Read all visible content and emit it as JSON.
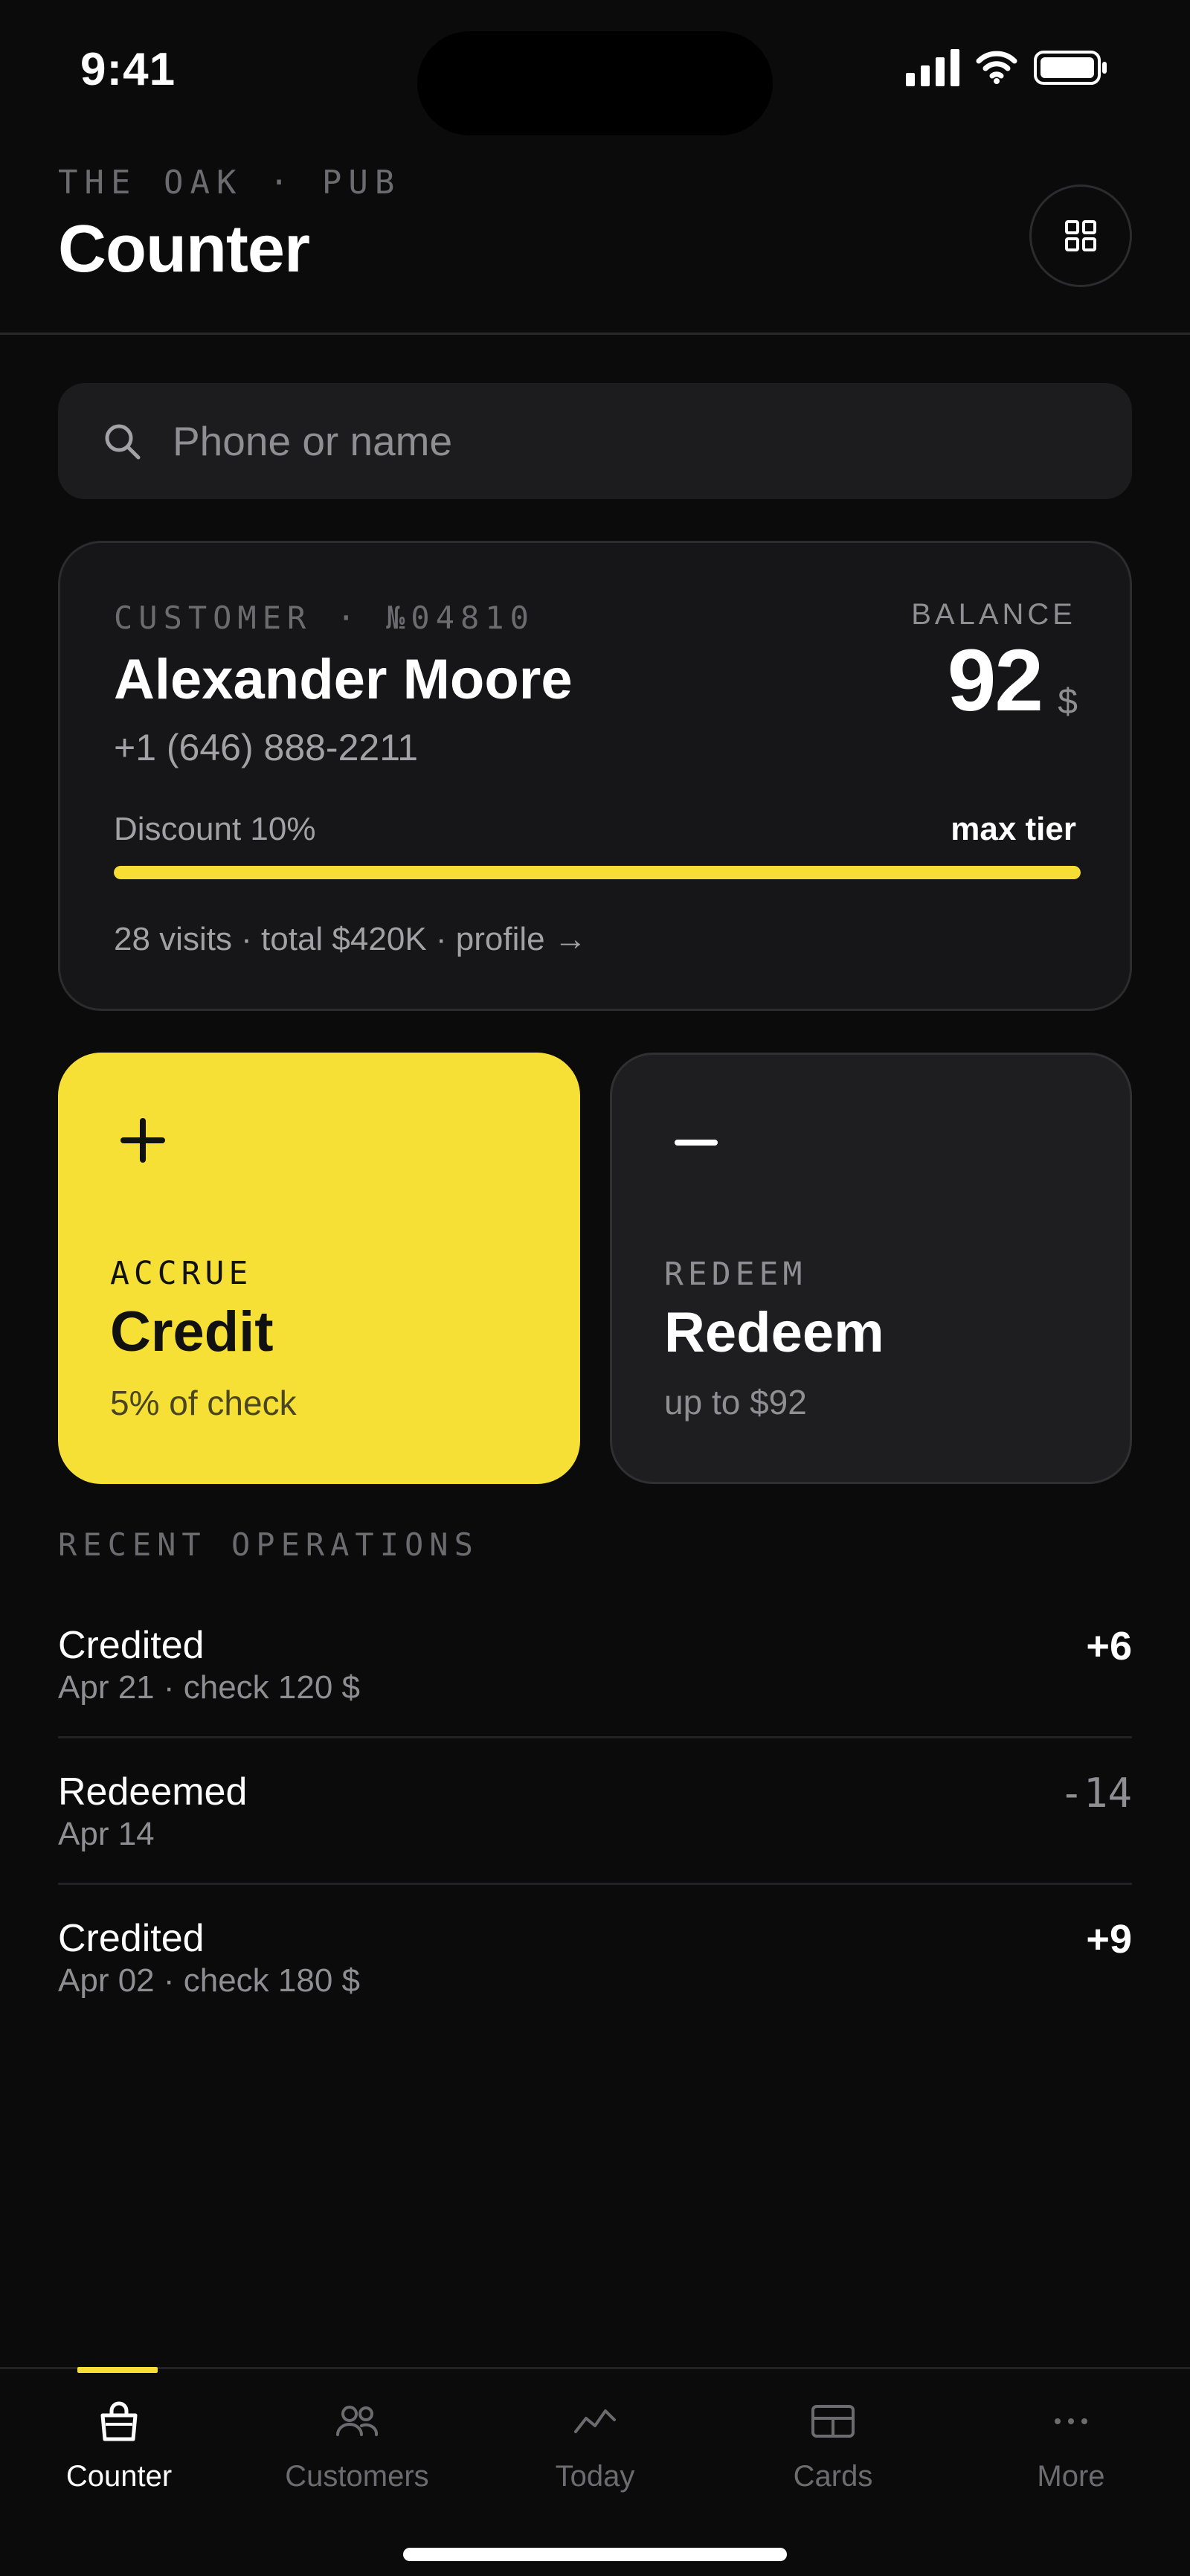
{
  "status_bar": {
    "time": "9:41"
  },
  "header": {
    "venue": "THE OAK · PUB",
    "title": "Counter"
  },
  "search": {
    "placeholder": "Phone or name",
    "value": ""
  },
  "customer": {
    "id_label": "CUSTOMER · №04810",
    "name": "Alexander Moore",
    "phone": "+1 (646) 888-2211",
    "balance_label": "BALANCE",
    "balance": "92",
    "balance_unit": "$",
    "discount_label": "Discount 10%",
    "tier_label": "max tier",
    "tier_progress": 1.0,
    "stats": "28 visits · total $420K · profile →"
  },
  "actions": {
    "accrue": {
      "glyph": "+",
      "kicker": "ACCRUE",
      "title": "Credit",
      "subtitle": "5% of check",
      "color": "#f6e035"
    },
    "redeem": {
      "glyph": "−",
      "kicker": "REDEEM",
      "title": "Redeem",
      "subtitle": "up to $92"
    }
  },
  "recent": {
    "label": "RECENT OPERATIONS",
    "items": [
      {
        "title": "Credited",
        "subtitle": "Apr 21 · check 120 $",
        "amount": "+6"
      },
      {
        "title": "Redeemed",
        "subtitle": "Apr 14",
        "amount": "-14"
      },
      {
        "title": "Credited",
        "subtitle": "Apr 02 · check 180 $",
        "amount": "+9"
      }
    ]
  },
  "tabs": [
    {
      "label": "Counter",
      "icon": "bag-icon",
      "active": true
    },
    {
      "label": "Customers",
      "icon": "users-icon",
      "active": false
    },
    {
      "label": "Today",
      "icon": "trend-icon",
      "active": false
    },
    {
      "label": "Cards",
      "icon": "card-icon",
      "active": false
    },
    {
      "label": "More",
      "icon": "more-icon",
      "active": false
    }
  ],
  "colors": {
    "accent": "#f6de35",
    "background": "#0b0b0c",
    "card": "#161618"
  }
}
